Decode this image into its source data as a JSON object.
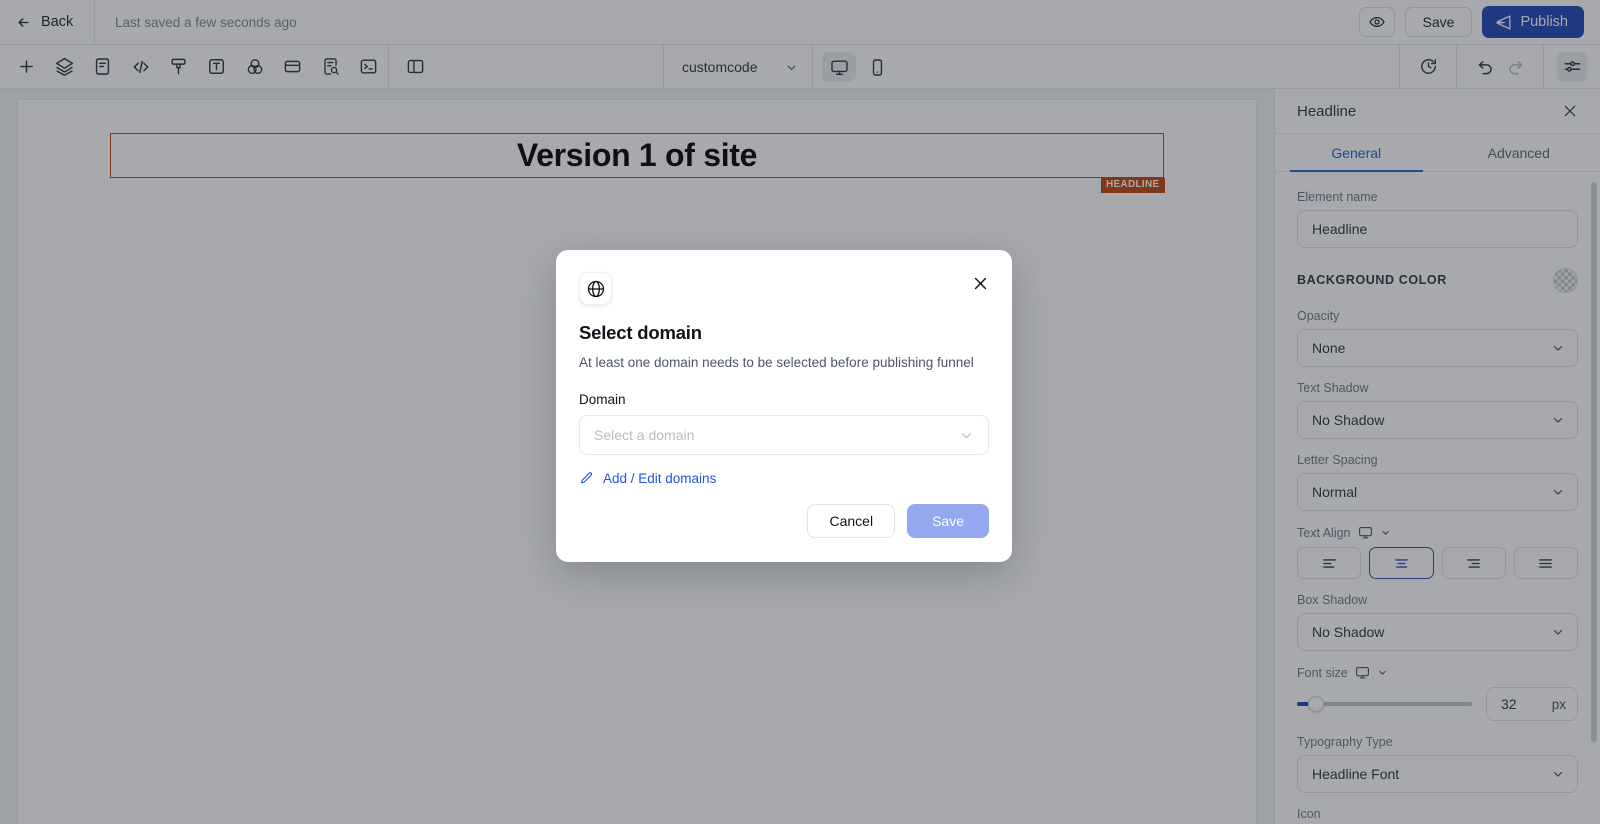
{
  "topbar": {
    "back_label": "Back",
    "saved_status": "Last saved a few seconds ago",
    "preview_icon": "eye-icon",
    "save_label": "Save",
    "publish_label": "Publish",
    "publish_icon": "send-icon",
    "publish_color": "#1b45b8"
  },
  "toolbar": {
    "tools": [
      {
        "name": "add-element-icon",
        "title": "Add"
      },
      {
        "name": "layers-icon",
        "title": "Layers"
      },
      {
        "name": "page-icon",
        "title": "Page"
      },
      {
        "name": "code-icon",
        "title": "Code"
      },
      {
        "name": "brush-icon",
        "title": "Brush"
      },
      {
        "name": "text-icon",
        "title": "Text"
      },
      {
        "name": "color-blend-icon",
        "title": "Colors"
      },
      {
        "name": "container-icon",
        "title": "Container"
      },
      {
        "name": "seo-audit-icon",
        "title": "SEO"
      },
      {
        "name": "terminal-icon",
        "title": "Terminal"
      }
    ],
    "panel_toggle_icon": "split-panel-icon",
    "page_select_value": "customcode",
    "devices": [
      {
        "name": "desktop-view",
        "icon": "monitor-icon",
        "active": true
      },
      {
        "name": "mobile-view",
        "icon": "phone-icon",
        "active": false
      }
    ],
    "history_icon": "history-clock-icon",
    "undo_icon": "undo-icon",
    "redo_icon": "redo-icon",
    "settings_icon": "sliders-icon"
  },
  "canvas": {
    "headline_text": "Version 1 of site",
    "selection_badge": "HEADLINE",
    "selection_color": "#c2410c"
  },
  "right_panel": {
    "title": "Headline",
    "close_icon": "close-icon",
    "tabs": [
      {
        "label": "General",
        "active": true
      },
      {
        "label": "Advanced",
        "active": false
      }
    ],
    "element_name_label": "Element name",
    "element_name_value": "Headline",
    "background_color_label": "BACKGROUND COLOR",
    "background_color_swatch": "transparent-checker",
    "opacity_label": "Opacity",
    "opacity_value": "None",
    "text_shadow_label": "Text Shadow",
    "text_shadow_value": "No Shadow",
    "letter_spacing_label": "Letter Spacing",
    "letter_spacing_value": "Normal",
    "text_align_label": "Text Align",
    "text_align_options": [
      {
        "name": "align-left",
        "active": false
      },
      {
        "name": "align-center",
        "active": true
      },
      {
        "name": "align-right",
        "active": false
      },
      {
        "name": "align-justify",
        "active": false
      }
    ],
    "box_shadow_label": "Box Shadow",
    "box_shadow_value": "No Shadow",
    "font_size_label": "Font size",
    "font_size_value": "32",
    "font_size_unit": "px",
    "typography_type_label": "Typography Type",
    "typography_type_value": "Headline Font",
    "icon_label": "Icon",
    "accent_color": "#2563c9"
  },
  "modal": {
    "icon": "globe-icon",
    "close_icon": "close-icon",
    "title": "Select domain",
    "subtitle": "At least one domain needs to be selected before publishing funnel",
    "domain_label": "Domain",
    "domain_placeholder": "Select a domain",
    "domain_value": "",
    "edit_link_label": "Add / Edit domains",
    "edit_link_icon": "pencil-icon",
    "cancel_label": "Cancel",
    "save_label": "Save",
    "save_disabled_color": "#93a8ee",
    "link_color": "#2451e6"
  }
}
